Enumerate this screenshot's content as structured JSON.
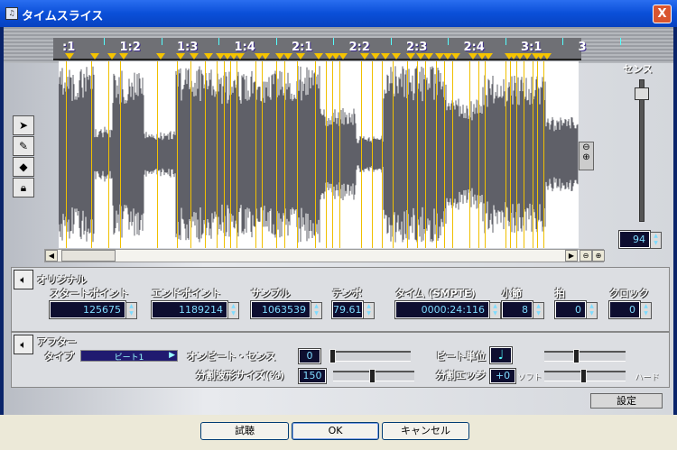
{
  "window": {
    "title": "タイムスライス",
    "close": "X"
  },
  "ruler": {
    "labels": [
      ":1",
      "1:2",
      "1:3",
      "1:4",
      "2:1",
      "2:2",
      "2:3",
      "2:4",
      "3:1",
      "3"
    ]
  },
  "tools": [
    "pointer",
    "pencil",
    "eraser",
    "lock"
  ],
  "sense": {
    "label": "センス",
    "value": "94",
    "level": 0.94
  },
  "original": {
    "title": "オリジナル",
    "fields": [
      {
        "label": "スタートポイント",
        "value": "125675"
      },
      {
        "label": "エンドポイント",
        "value": "1189214"
      },
      {
        "label": "サンプル",
        "value": "1063539"
      },
      {
        "label": "テンポ",
        "value": "79.61"
      },
      {
        "label": "タイム (SMPTE)",
        "value": "0000:24:116"
      },
      {
        "label": "小節",
        "value": "8"
      },
      {
        "label": "拍",
        "value": "0"
      },
      {
        "label": "クロック",
        "value": "0"
      }
    ]
  },
  "after": {
    "title": "アフター",
    "type_label": "タイプ",
    "type_value": "ビート1",
    "onbeat_label": "オンビート・センス",
    "onbeat_value": "0",
    "onbeat_level": 0,
    "split_size_label": "分割波形サイズ(%)",
    "split_size_value": "150",
    "split_size_level": 0.5,
    "beat_unit_label": "ビート単位",
    "beat_unit_icon": "♩",
    "beat_unit_level": 0.4,
    "edge_label": "分割エッジ",
    "edge_value": "+0",
    "edge_soft": "ソフト",
    "edge_hard": "ハード",
    "edge_level": 0.5
  },
  "settings_button": "設定",
  "buttons": {
    "preview": "試聴",
    "ok": "OK",
    "cancel": "キャンセル"
  }
}
